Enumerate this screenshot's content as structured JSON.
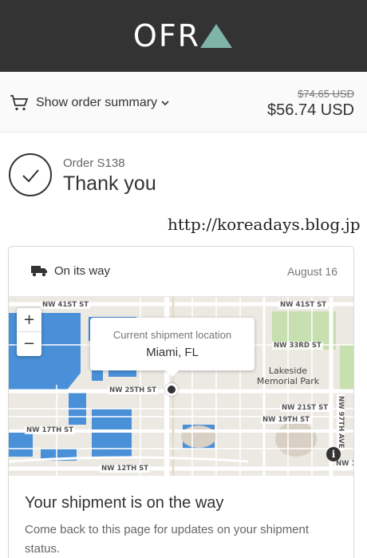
{
  "header": {
    "logo_text": "OFR",
    "logo_label": "OFRA"
  },
  "summary": {
    "toggle_label": "Show order summary",
    "price_original": "$74.65 USD",
    "price_total": "$56.74 USD"
  },
  "order": {
    "number": "Order S138",
    "title": "Thank you"
  },
  "watermark": "http://koreadays.blog.jp",
  "shipment": {
    "status": "On its way",
    "date": "August 16",
    "map": {
      "popup_title": "Current shipment location",
      "popup_city": "Miami, FL",
      "zoom_in": "+",
      "zoom_out": "−",
      "info": "i",
      "labels": {
        "nw41_left": "NW 41ST ST",
        "nw41_right": "NW 41ST ST",
        "nw33": "NW 33RD ST",
        "park": "Lakeside\nMemorial Park",
        "nw25": "NW 25TH ST",
        "nw21": "NW 21ST ST",
        "nw19": "NW 19TH ST",
        "nw17": "NW 17TH ST",
        "nw12": "NW 12TH ST",
        "nw97": "NW 97TH AVE",
        "nw1x": "NW 1"
      }
    },
    "heading": "Your shipment is on the way",
    "description": "Come back to this page for updates on your shipment status."
  },
  "colors": {
    "header_bg": "#333333",
    "logo_accent": "#7fb5a8",
    "water": "#4a90d9",
    "park": "#c8dfb0"
  }
}
